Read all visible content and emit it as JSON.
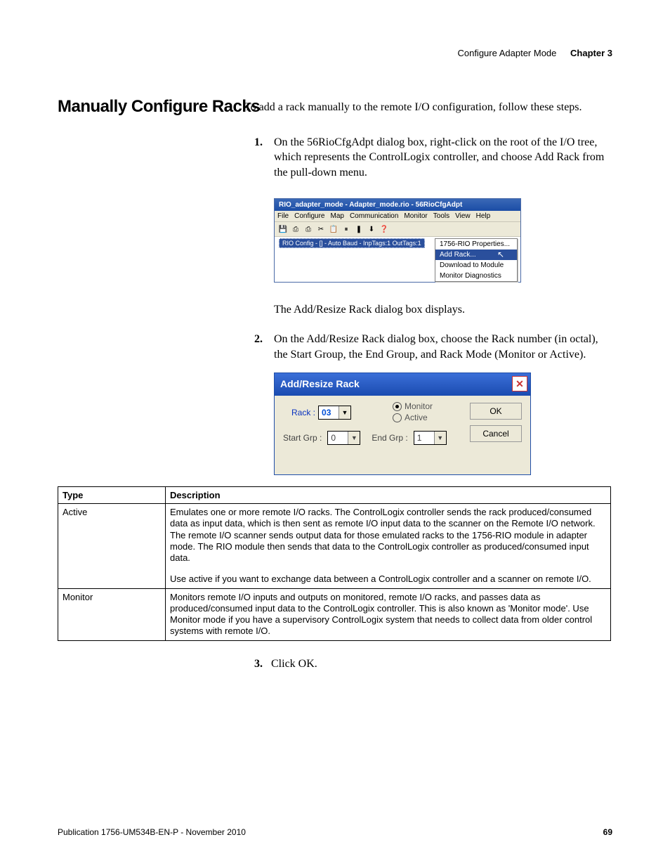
{
  "header": {
    "crumb": "Configure Adapter Mode",
    "chapter": "Chapter 3"
  },
  "section_heading": "Manually Configure Racks",
  "intro": "To add a rack manually to the remote I/O configuration, follow these steps.",
  "step1_num": "1.",
  "step1_text": "On the 56RioCfgAdpt dialog box, right-click on the root of the I/O tree, which represents the ControlLogix controller, and choose Add Rack from the pull-down menu.",
  "dlg1": {
    "title": "RIO_adapter_mode - Adapter_mode.rio - 56RioCfgAdpt",
    "menus": [
      "File",
      "Configure",
      "Map",
      "Communication",
      "Monitor",
      "Tools",
      "View",
      "Help"
    ],
    "toolbar_icons": [
      "💾",
      "⎙",
      "⎙",
      "✂",
      "📋",
      "⏸",
      "❚",
      "⬇",
      "❓"
    ],
    "tree_item": "RIO Config - [] - Auto Baud - InpTags:1 OutTags:1",
    "ctx": {
      "item1": "1756-RIO Properties...",
      "item_sel": "Add Rack...",
      "item3": "Download to Module",
      "item4": "Monitor Diagnostics"
    }
  },
  "after_dlg1": "The Add/Resize Rack dialog box displays.",
  "step2_num": "2.",
  "step2_text": "On the Add/Resize Rack dialog box, choose the Rack number (in octal), the Start Group, the End Group, and Rack Mode (Monitor or Active).",
  "dlg2": {
    "title": "Add/Resize Rack",
    "rack_label": "Rack :",
    "rack_value": "03",
    "radio_monitor": "Monitor",
    "radio_active": "Active",
    "start_label": "Start Grp :",
    "start_value": "0",
    "end_label": "End Grp :",
    "end_value": "1",
    "ok": "OK",
    "cancel": "Cancel"
  },
  "table": {
    "h_type": "Type",
    "h_desc": "Description",
    "r1_type": "Active",
    "r1_desc_a": "Emulates one or more remote I/O racks. The ControlLogix controller sends the rack produced/consumed data as input data, which is then sent as remote I/O input data to the scanner on the Remote I/O network. The remote I/O scanner sends output data for those emulated racks to the 1756-RIO module in adapter mode. The RIO module then sends that data to the ControlLogix controller as produced/consumed input data.",
    "r1_desc_b": "Use active if you want to exchange data between a ControlLogix controller and a scanner on remote I/O.",
    "r2_type": "Monitor",
    "r2_desc": "Monitors remote I/O inputs and outputs on monitored, remote I/O racks, and passes data as produced/consumed input data to the ControlLogix controller. This is also known as 'Monitor mode'. Use Monitor mode if you have a supervisory ControlLogix system that needs to collect data from older control systems with remote I/O."
  },
  "step3_num": "3.",
  "step3_text": "Click OK.",
  "footer": {
    "pub": "Publication 1756-UM534B-EN-P - November 2010",
    "page": "69"
  }
}
